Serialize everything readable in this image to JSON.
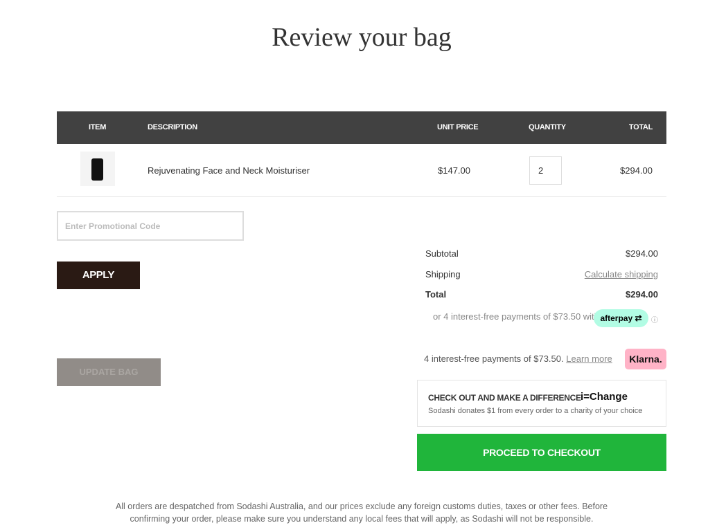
{
  "page": {
    "title": "Review your bag"
  },
  "table": {
    "headers": {
      "item": "ITEM",
      "description": "DESCRIPTION",
      "unit_price": "UNIT PRICE",
      "quantity": "QUANTITY",
      "total": "TOTAL"
    },
    "rows": [
      {
        "description": "Rejuvenating Face and Neck Moisturiser",
        "unit_price": "$147.00",
        "quantity": "2",
        "total": "$294.00"
      }
    ]
  },
  "promo": {
    "placeholder": "Enter Promotional Code",
    "apply_label": "APPLY"
  },
  "update_label": "UPDATE BAG",
  "summary": {
    "subtotal_label": "Subtotal",
    "subtotal": "$294.00",
    "shipping_label": "Shipping",
    "shipping_link": "Calculate shipping",
    "total_label": "Total",
    "total": "$294.00"
  },
  "afterpay": {
    "text": "or 4 interest-free payments of $73.50 with",
    "logo": "afterpay",
    "icon": "info-icon"
  },
  "klarna": {
    "text": "4 interest-free payments of $73.50.",
    "link": "Learn more",
    "logo": "Klarna."
  },
  "ichange": {
    "heading": "CHECK OUT AND MAKE A DIFFERENCE",
    "logo": "i=Change",
    "sub": "Sodashi donates $1 from every order to a charity of your choice"
  },
  "checkout_label": "PROCEED TO CHECKOUT",
  "footer": "All orders are despatched from Sodashi Australia, and our prices exclude any foreign customs duties, taxes or other fees. Before confirming your order, please make sure you understand any local fees that will apply, as Sodashi will not be responsible.",
  "colors": {
    "header": "#414141",
    "checkout": "#20b53b",
    "afterpay": "#b2fce4",
    "klarna": "#ffb3c7",
    "apply": "#2a1a14"
  }
}
